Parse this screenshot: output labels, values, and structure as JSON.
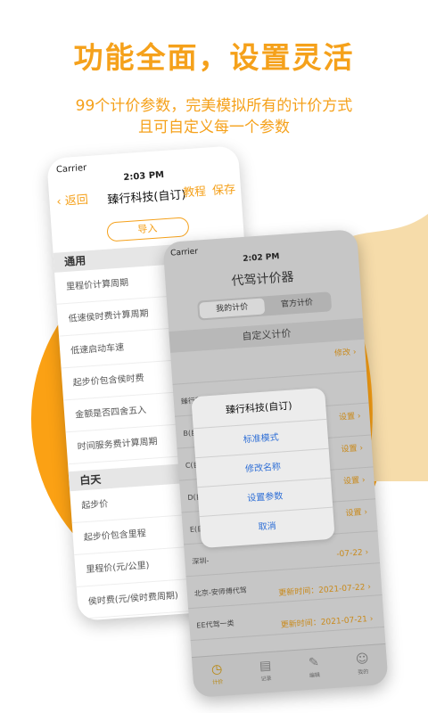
{
  "promo": {
    "headline": "功能全面，设置灵活",
    "sub1": "99个计价参数，完美模拟所有的计价方式",
    "sub2": "且可自定义每一个参数"
  },
  "colors": {
    "accent": "#f5a11b",
    "sun": "#fba114"
  },
  "phone_left": {
    "status": {
      "carrier": "Carrier",
      "time": "2:03 PM"
    },
    "nav": {
      "back": "返回",
      "title": "臻行科技(自订)",
      "tutorial": "教程",
      "save": "保存"
    },
    "import_button": "导入",
    "sections": [
      {
        "title": "通用",
        "rows": [
          "里程价计算周期",
          "低速侯时费计算周期",
          "低速启动车速",
          "起步价包含侯时费",
          "金额是否四舍五入",
          "时间服务费计算周期"
        ]
      },
      {
        "title": "白天",
        "rows": [
          "起步价",
          "起步价包含里程",
          "里程价(元/公里)",
          "侯时费(元/侯时费周期)"
        ]
      }
    ]
  },
  "phone_right": {
    "status": {
      "carrier": "Carrier",
      "time": "2:02 PM"
    },
    "title": "代驾计价器",
    "segments": [
      "我的计价",
      "官方计价"
    ],
    "section": "自定义计价",
    "rows": [
      {
        "name": "",
        "action": "修改"
      },
      {
        "name": "臻行科技(自订)",
        "action": ""
      },
      {
        "name": "B(自订",
        "action": "设置"
      },
      {
        "name": "C(自订",
        "action": "设置"
      },
      {
        "name": "D(自订",
        "action": "设置"
      },
      {
        "name": "E(自订",
        "action": "设置"
      },
      {
        "name": "深圳-",
        "date": "-07-22"
      },
      {
        "name": "北京-安师傅代驾",
        "date": "更新时间：2021-07-22"
      },
      {
        "name": "EE代驾一类",
        "date": "更新时间：2021-07-21"
      }
    ],
    "tabs": [
      {
        "icon": "clock-icon",
        "label": "计价"
      },
      {
        "icon": "document-icon",
        "label": "记录"
      },
      {
        "icon": "edit-icon",
        "label": "编辑"
      },
      {
        "icon": "user-icon",
        "label": "我的"
      }
    ]
  },
  "action_sheet": {
    "title": "臻行科技(自订)",
    "options": [
      "标准模式",
      "修改名称",
      "设置参数",
      "取消"
    ]
  }
}
